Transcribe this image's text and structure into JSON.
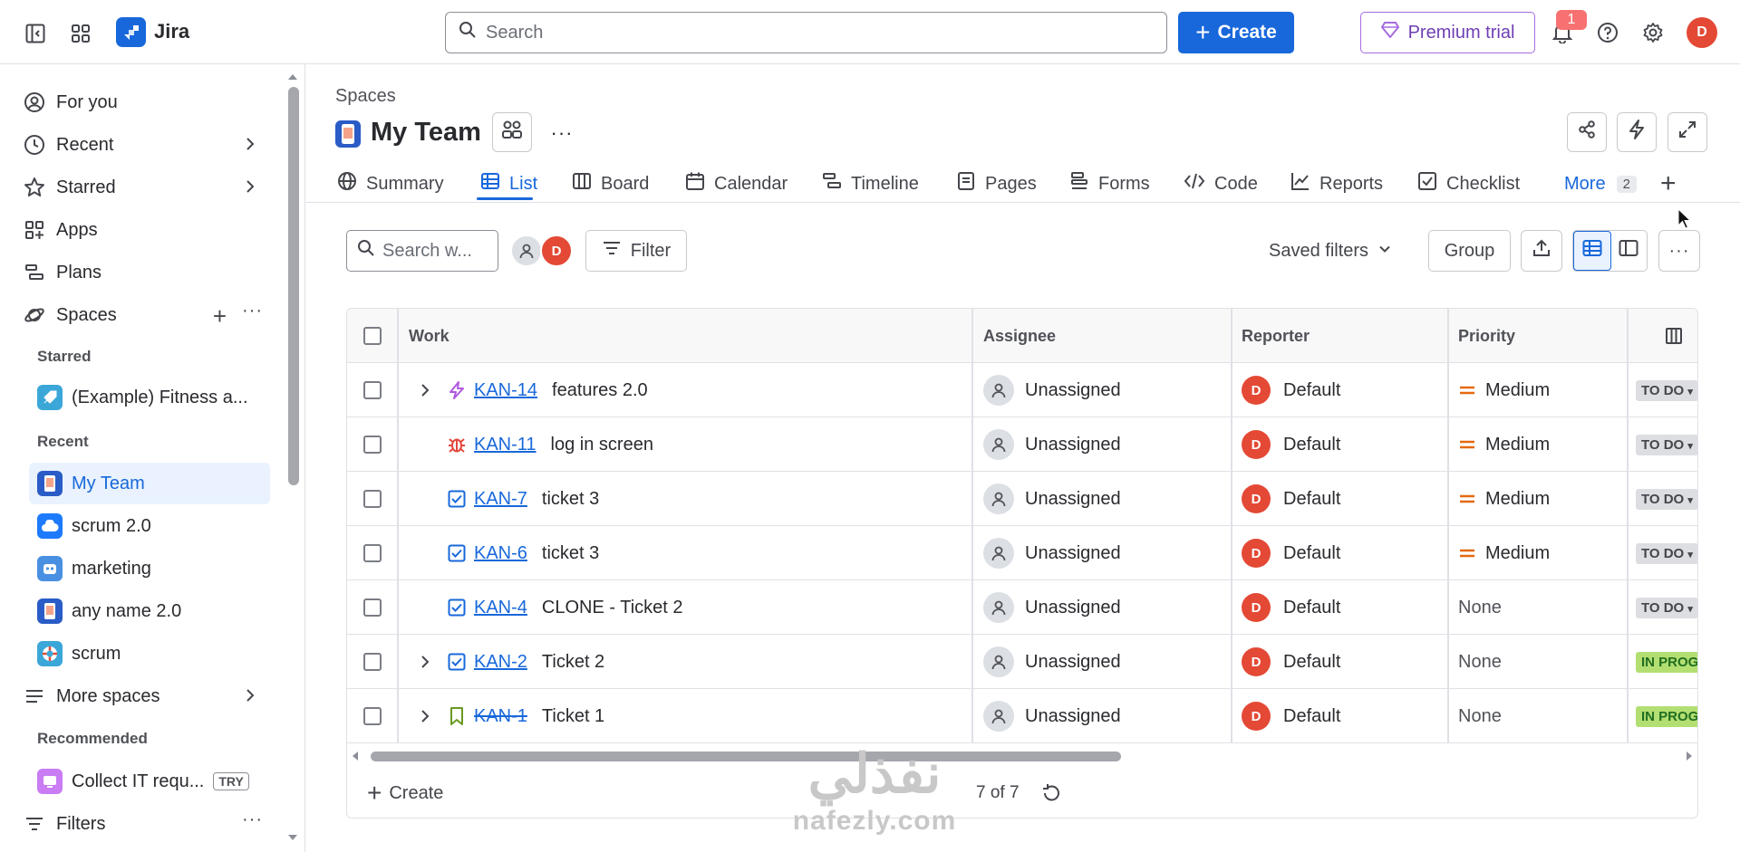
{
  "topbar": {
    "app_name": "Jira",
    "search_placeholder": "Search",
    "create_label": "Create",
    "premium_label": "Premium trial",
    "notification_count": "1",
    "user_initial": "D"
  },
  "sidebar": {
    "nav": [
      {
        "label": "For you"
      },
      {
        "label": "Recent"
      },
      {
        "label": "Starred"
      },
      {
        "label": "Apps"
      },
      {
        "label": "Plans"
      },
      {
        "label": "Spaces"
      }
    ],
    "starred_heading": "Starred",
    "starred": [
      {
        "label": "(Example) Fitness a..."
      }
    ],
    "recent_heading": "Recent",
    "recent": [
      {
        "label": "My Team"
      },
      {
        "label": "scrum 2.0"
      },
      {
        "label": "marketing"
      },
      {
        "label": "any name 2.0"
      },
      {
        "label": "scrum"
      }
    ],
    "more_spaces": "More spaces",
    "recommended_heading": "Recommended",
    "recommended": {
      "label": "Collect IT requ...",
      "badge": "TRY"
    },
    "filters": "Filters"
  },
  "main": {
    "breadcrumb": "Spaces",
    "title": "My Team",
    "tabs": [
      {
        "label": "Summary"
      },
      {
        "label": "List"
      },
      {
        "label": "Board"
      },
      {
        "label": "Calendar"
      },
      {
        "label": "Timeline"
      },
      {
        "label": "Pages"
      },
      {
        "label": "Forms"
      },
      {
        "label": "Code"
      },
      {
        "label": "Reports"
      },
      {
        "label": "Checklist"
      }
    ],
    "more_tab": "More",
    "more_count": "2",
    "toolbar": {
      "search_placeholder": "Search w...",
      "avatar_initial": "D",
      "filter_label": "Filter",
      "saved_filters_label": "Saved filters",
      "group_label": "Group"
    },
    "table": {
      "columns": [
        "Work",
        "Assignee",
        "Reporter",
        "Priority"
      ],
      "rows": [
        {
          "key": "KAN-14",
          "summary": "features 2.0",
          "type": "epic",
          "expandable": true,
          "done": false,
          "assignee": "Unassigned",
          "reporter_initial": "D",
          "reporter": "Default",
          "priority": "Medium",
          "status": "TO DO"
        },
        {
          "key": "KAN-11",
          "summary": "log in screen",
          "type": "bug",
          "expandable": false,
          "done": false,
          "assignee": "Unassigned",
          "reporter_initial": "D",
          "reporter": "Default",
          "priority": "Medium",
          "status": "TO DO"
        },
        {
          "key": "KAN-7",
          "summary": "ticket 3",
          "type": "task",
          "expandable": false,
          "done": false,
          "assignee": "Unassigned",
          "reporter_initial": "D",
          "reporter": "Default",
          "priority": "Medium",
          "status": "TO DO"
        },
        {
          "key": "KAN-6",
          "summary": "ticket 3",
          "type": "task",
          "expandable": false,
          "done": false,
          "assignee": "Unassigned",
          "reporter_initial": "D",
          "reporter": "Default",
          "priority": "Medium",
          "status": "TO DO"
        },
        {
          "key": "KAN-4",
          "summary": "CLONE - Ticket 2",
          "type": "task",
          "expandable": false,
          "done": false,
          "assignee": "Unassigned",
          "reporter_initial": "D",
          "reporter": "Default",
          "priority": "None",
          "status": "TO DO"
        },
        {
          "key": "KAN-2",
          "summary": "Ticket 2",
          "type": "task",
          "expandable": true,
          "done": false,
          "assignee": "Unassigned",
          "reporter_initial": "D",
          "reporter": "Default",
          "priority": "None",
          "status": "IN PROG"
        },
        {
          "key": "KAN-1",
          "summary": "Ticket 1",
          "type": "story",
          "expandable": true,
          "done": true,
          "assignee": "Unassigned",
          "reporter_initial": "D",
          "reporter": "Default",
          "priority": "None",
          "status": "IN PROG"
        }
      ],
      "create_label": "Create",
      "count_label": "7 of 7"
    }
  },
  "watermark": {
    "arabic": "نفذلي",
    "latin": "nafezly.com"
  },
  "colors": {
    "accent": "#1868db",
    "avatar": "#e34935",
    "premium": "#6e3fb4",
    "medium_priority": "#e56910",
    "todo_bg": "#dddee1",
    "inprog_bg": "#b3df72"
  }
}
